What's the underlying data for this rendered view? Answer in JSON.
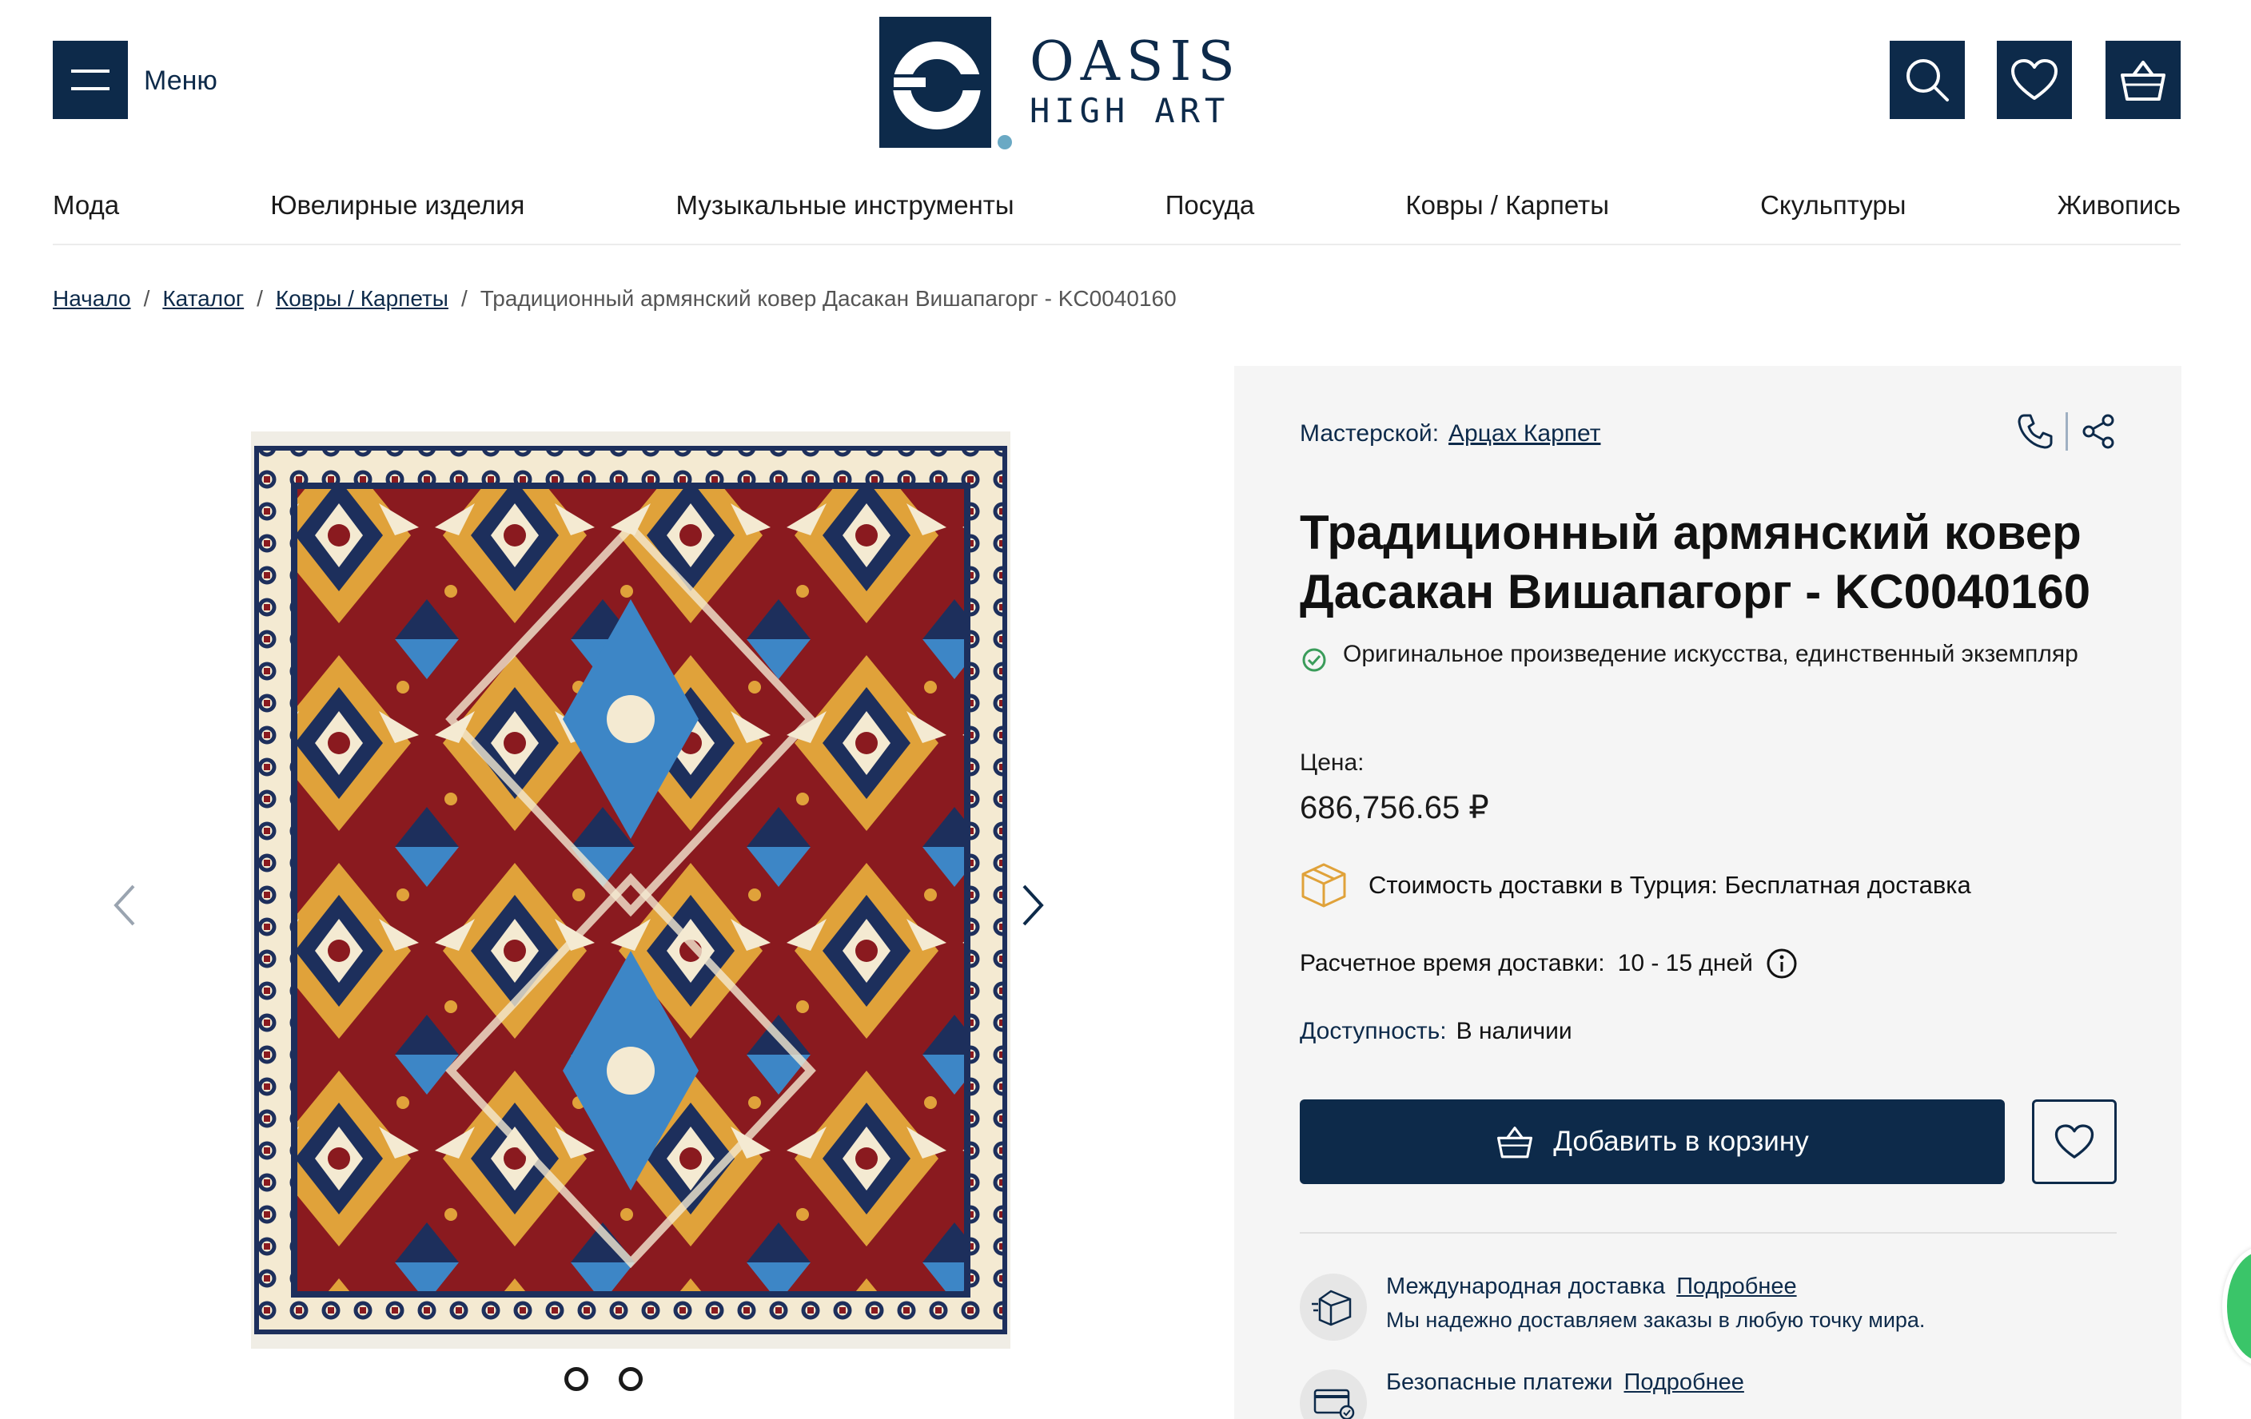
{
  "header": {
    "menu_label": "Меню",
    "logo_line1": "OASIS",
    "logo_line2": "HIGH ART",
    "icons": [
      "search-icon",
      "heart-icon",
      "basket-icon"
    ]
  },
  "nav": {
    "items": [
      "Мода",
      "Ювелирные изделия",
      "Музыкальные инструменты",
      "Посуда",
      "Ковры / Карпеты",
      "Скульптуры",
      "Живопись"
    ]
  },
  "breadcrumb": {
    "items": [
      "Начало",
      "Каталог",
      "Ковры / Карпеты"
    ],
    "separator": "/",
    "current": "Традиционный армянский ковер Дасакан Вишапагорг - KC0040160"
  },
  "gallery": {
    "slides_count": 2
  },
  "product": {
    "maker_label": "Мастерской:",
    "maker_name": "Арцах Карпет",
    "title": "Традиционный армянский ковер Дасакан Вишапагорг - KC0040160",
    "original_note": "Оригинальное произведение искусства, единственный экземпляр",
    "price_label": "Цена:",
    "price": "686,756.65 ₽",
    "delivery_cost": "Стоимость доставки в Турция: Бесплатная доставка",
    "delivery_time_label": "Расчетное время доставки:",
    "delivery_time_value": "10 - 15 дней",
    "availability_label": "Доступность:",
    "availability_value": "В наличии",
    "add_to_cart": "Добавить в корзину"
  },
  "features": [
    {
      "title": "Международная доставка",
      "link": "Подробнее",
      "desc": "Мы надежно доставляем заказы в любую точку мира."
    },
    {
      "title": "Безопасные платежи",
      "link": "Подробнее",
      "desc": ""
    }
  ],
  "colors": {
    "brand": "#0d2a4a",
    "accent_dot": "#6aa9c4",
    "panel_bg": "#f5f5f5",
    "rug_red": "#8a1a1f",
    "rug_navy": "#1d2f5c",
    "rug_gold": "#e0a23a",
    "rug_blue": "#3d86c6",
    "rug_cream": "#f4ead2"
  }
}
